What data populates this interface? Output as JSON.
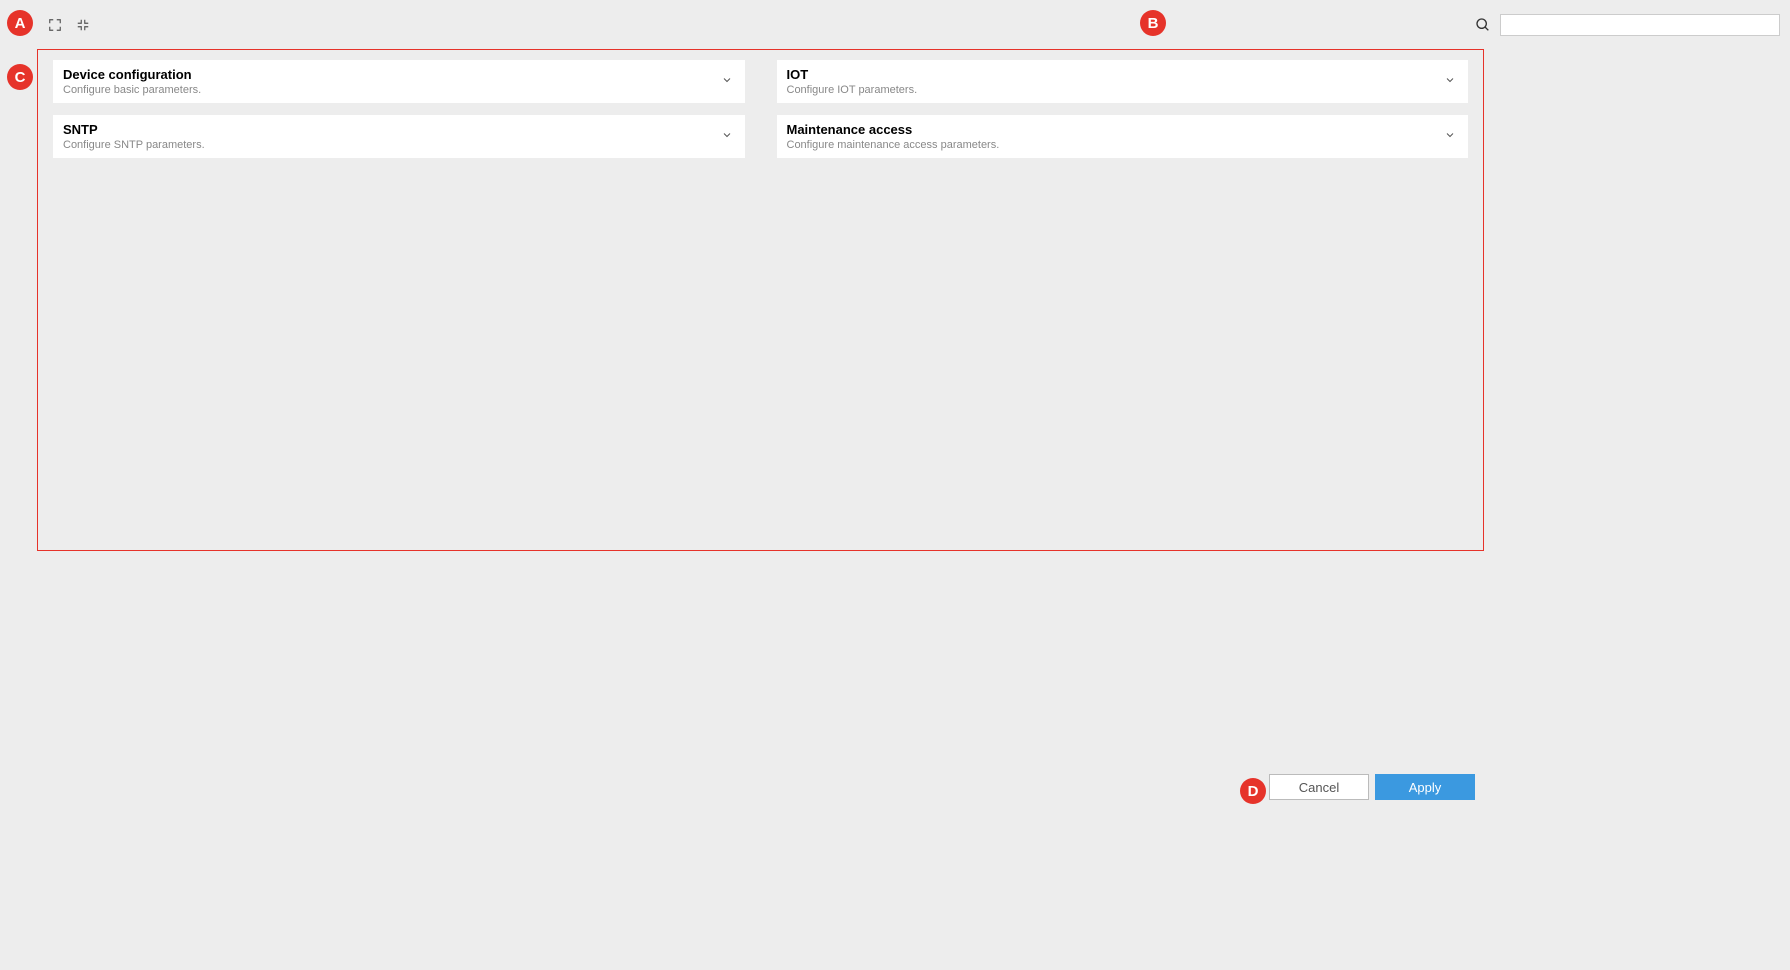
{
  "toolbar": {
    "search_placeholder": ""
  },
  "panels": {
    "left": [
      {
        "title": "Device configuration",
        "desc": "Configure basic parameters."
      },
      {
        "title": "SNTP",
        "desc": "Configure SNTP parameters."
      }
    ],
    "right": [
      {
        "title": "IOT",
        "desc": "Configure IOT parameters."
      },
      {
        "title": "Maintenance access",
        "desc": "Configure maintenance access parameters."
      }
    ]
  },
  "footer": {
    "cancel_label": "Cancel",
    "apply_label": "Apply"
  },
  "badges": {
    "a": "A",
    "b": "B",
    "c": "C",
    "d": "D"
  }
}
